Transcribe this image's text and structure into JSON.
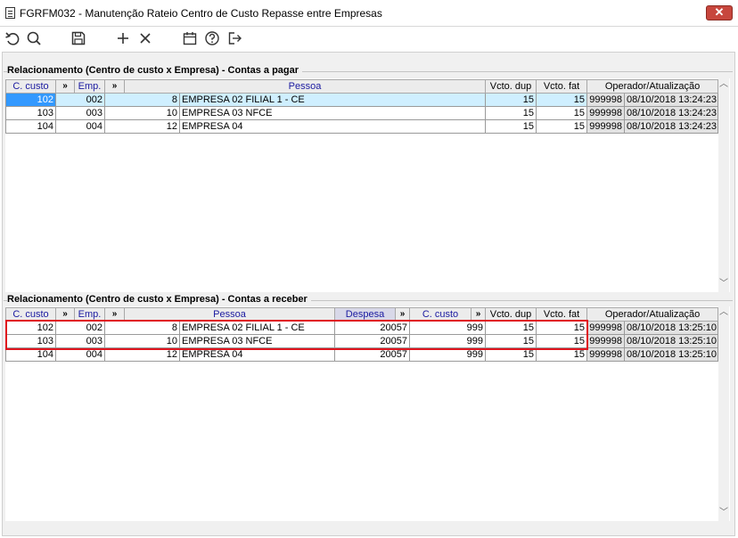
{
  "window": {
    "title": "FGRFM032 - Manutenção Rateio Centro de Custo Repasse entre Empresas",
    "close_glyph": "✕"
  },
  "toolbar": {
    "buttons": [
      {
        "icon": "undo-icon"
      },
      {
        "icon": "search-icon"
      },
      {
        "icon": "save-icon"
      },
      {
        "icon": "plus-icon"
      },
      {
        "icon": "close-icon"
      },
      {
        "icon": "calendar-icon"
      },
      {
        "icon": "help-icon"
      },
      {
        "icon": "exit-icon"
      }
    ]
  },
  "pagar": {
    "title": "Relacionamento (Centro de custo x Empresa) - Contas a pagar",
    "headers": {
      "ccusto": "C. custo",
      "sep": "»",
      "emp": "Emp.",
      "pessoa": "Pessoa",
      "vcto_dup": "Vcto. dup",
      "vcto_fat": "Vcto. fat",
      "operador": "Operador/Atualização"
    },
    "rows": [
      {
        "ccusto": "102",
        "emp": "002",
        "pcode": "8",
        "pname": "EMPRESA 02 FILIAL 1 - CE",
        "vdup": "15",
        "vfat": "15",
        "op": "999998",
        "dt": "08/10/2018 13:24:23"
      },
      {
        "ccusto": "103",
        "emp": "003",
        "pcode": "10",
        "pname": "EMPRESA 03 NFCE",
        "vdup": "15",
        "vfat": "15",
        "op": "999998",
        "dt": "08/10/2018 13:24:23"
      },
      {
        "ccusto": "104",
        "emp": "004",
        "pcode": "12",
        "pname": "EMPRESA 04",
        "vdup": "15",
        "vfat": "15",
        "op": "999998",
        "dt": "08/10/2018 13:24:23"
      }
    ]
  },
  "receber": {
    "title": "Relacionamento (Centro de custo x Empresa) - Contas a receber",
    "headers": {
      "ccusto": "C. custo",
      "sep": "»",
      "emp": "Emp.",
      "pessoa": "Pessoa",
      "despesa": "Despesa",
      "ccusto2": "C. custo",
      "vcto_dup": "Vcto. dup",
      "vcto_fat": "Vcto. fat",
      "operador": "Operador/Atualização"
    },
    "rows": [
      {
        "ccusto": "102",
        "emp": "002",
        "pcode": "8",
        "pname": "EMPRESA 02 FILIAL 1 - CE",
        "despesa": "20057",
        "cc2": "999",
        "vdup": "15",
        "vfat": "15",
        "op": "999998",
        "dt": "08/10/2018 13:25:10"
      },
      {
        "ccusto": "103",
        "emp": "003",
        "pcode": "10",
        "pname": "EMPRESA 03 NFCE",
        "despesa": "20057",
        "cc2": "999",
        "vdup": "15",
        "vfat": "15",
        "op": "999998",
        "dt": "08/10/2018 13:25:10"
      },
      {
        "ccusto": "104",
        "emp": "004",
        "pcode": "12",
        "pname": "EMPRESA 04",
        "despesa": "20057",
        "cc2": "999",
        "vdup": "15",
        "vfat": "15",
        "op": "999998",
        "dt": "08/10/2018 13:25:10"
      }
    ]
  },
  "colors": {
    "highlight": "#e0141e",
    "selected": "#3399ff",
    "selected_row": "#cfefff",
    "header_text": "#1a1aa0"
  }
}
